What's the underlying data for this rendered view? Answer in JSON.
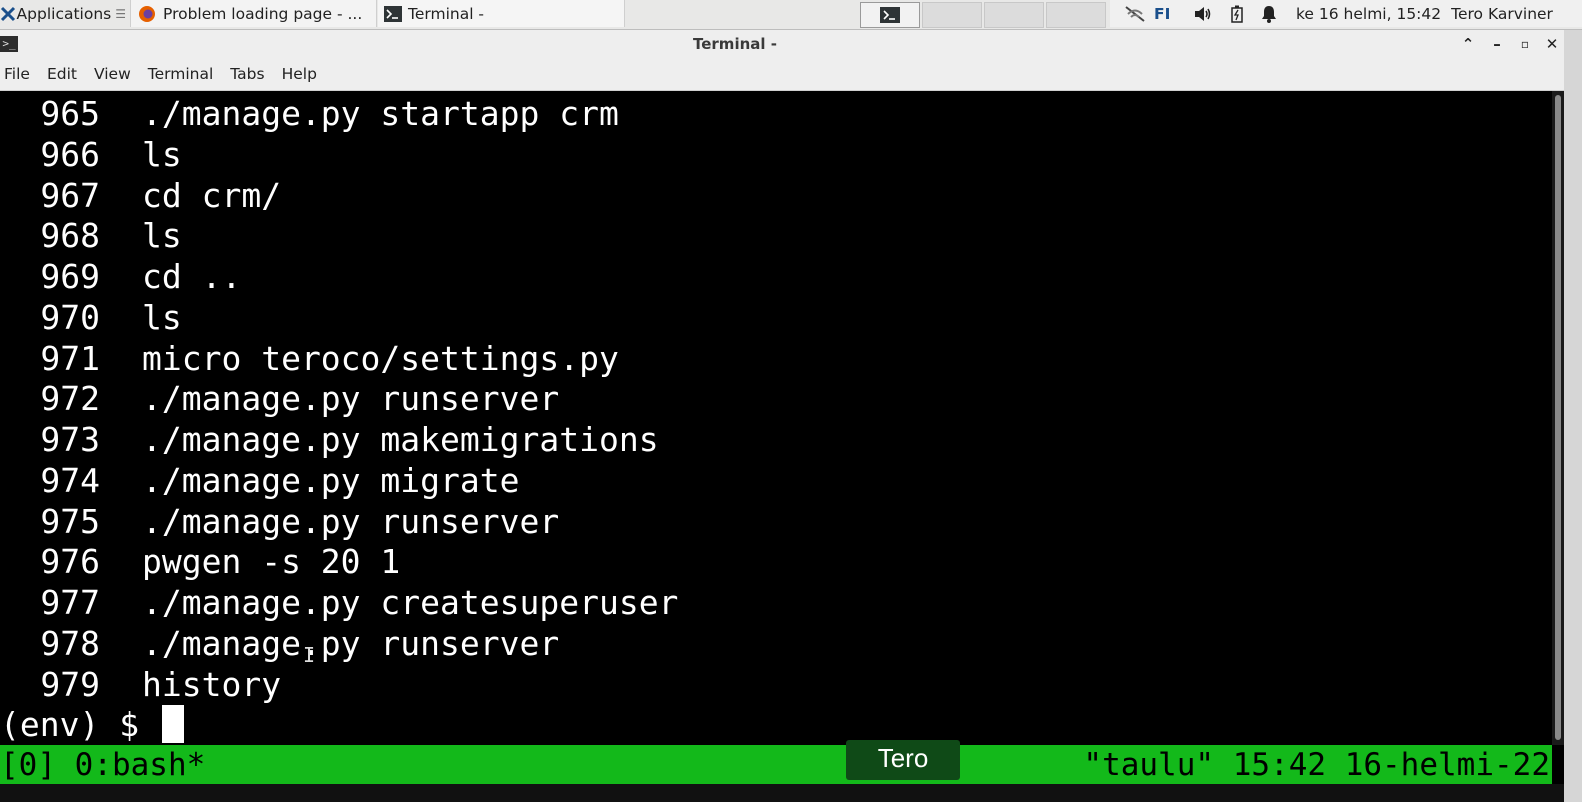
{
  "panel": {
    "applications_label": "Applications",
    "tasks": [
      {
        "label": "Problem loading page - ...",
        "icon": "firefox-icon"
      },
      {
        "label": "Terminal -",
        "icon": "terminal-icon"
      }
    ],
    "keyboard_layout": "FI",
    "clock": "ke 16 helmi, 15:42",
    "user": "Tero Karviner"
  },
  "window": {
    "title": "Terminal -",
    "menu": [
      "File",
      "Edit",
      "View",
      "Terminal",
      "Tabs",
      "Help"
    ]
  },
  "terminal": {
    "history": [
      {
        "num": "965",
        "cmd": "./manage.py startapp crm"
      },
      {
        "num": "966",
        "cmd": "ls"
      },
      {
        "num": "967",
        "cmd": "cd crm/"
      },
      {
        "num": "968",
        "cmd": "ls"
      },
      {
        "num": "969",
        "cmd": "cd .."
      },
      {
        "num": "970",
        "cmd": "ls"
      },
      {
        "num": "971",
        "cmd": "micro teroco/settings.py"
      },
      {
        "num": "972",
        "cmd": "./manage.py runserver"
      },
      {
        "num": "973",
        "cmd": "./manage.py makemigrations"
      },
      {
        "num": "974",
        "cmd": "./manage.py migrate"
      },
      {
        "num": "975",
        "cmd": "./manage.py runserver"
      },
      {
        "num": "976",
        "cmd": "pwgen -s 20 1"
      },
      {
        "num": "977",
        "cmd": "./manage.py createsuperuser"
      },
      {
        "num": "978",
        "cmd": "./manage.py runserver"
      },
      {
        "num": "979",
        "cmd": "history"
      }
    ],
    "prompt": "(env) $ "
  },
  "tmux": {
    "left": "[0] 0:bash*",
    "right": "\"taulu\" 15:42 16-helmi-22"
  },
  "overlay_label": "Tero",
  "colors": {
    "terminal_bg": "#000000",
    "terminal_fg": "#ffffff",
    "tmux_bar": "#13b91a",
    "overlay_bg": "#0f4a17"
  }
}
